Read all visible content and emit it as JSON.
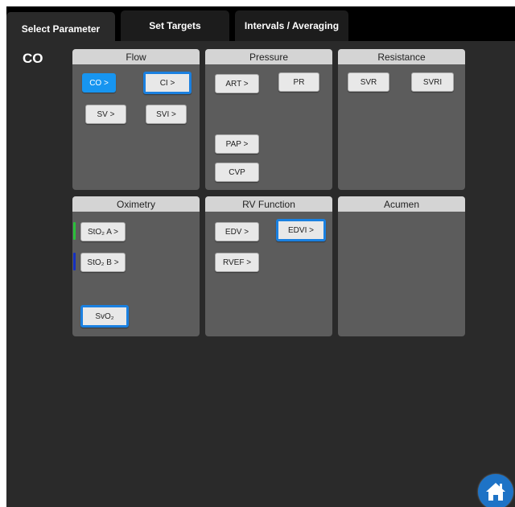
{
  "tabs": [
    {
      "label": "Select Parameter"
    },
    {
      "label": "Set Targets"
    },
    {
      "label": "Intervals / Averaging"
    }
  ],
  "current_parameter": "CO",
  "panels": {
    "flow": {
      "title": "Flow",
      "buttons": [
        "CO >",
        "CI >",
        "SV >",
        "SVI >"
      ]
    },
    "pressure": {
      "title": "Pressure",
      "buttons": [
        "ART >",
        "PR",
        "PAP >",
        "CVP"
      ]
    },
    "resistance": {
      "title": "Resistance",
      "buttons": [
        "SVR",
        "SVRI"
      ]
    },
    "oximetry": {
      "title": "Oximetry",
      "buttons": [
        "StO₂ A >",
        "StO₂ B >",
        "SvO₂"
      ]
    },
    "rv_function": {
      "title": "RV Function",
      "buttons": [
        "EDV >",
        "EDVI >",
        "RVEF >"
      ]
    },
    "acumen": {
      "title": "Acumen"
    }
  },
  "colors": {
    "accent": "#1795f0",
    "selected_border": "#1a80e0",
    "sto2_a_indicator": "#2bbf3a",
    "sto2_b_indicator": "#1530c0",
    "home_button": "#1e73c6"
  },
  "icons": {
    "home": "home-icon"
  }
}
